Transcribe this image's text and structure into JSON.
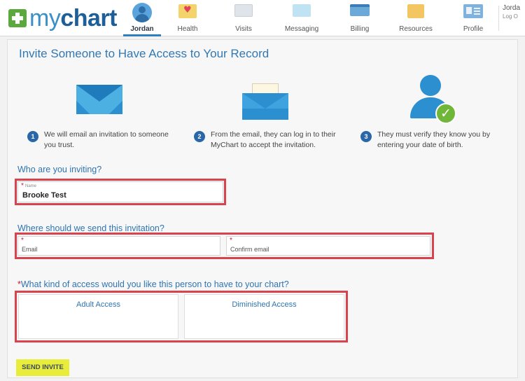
{
  "brand": {
    "my": "my",
    "chart": "chart"
  },
  "nav": {
    "user": "Jordan",
    "items": [
      "Health",
      "Visits",
      "Messaging",
      "Billing",
      "Resources",
      "Profile"
    ],
    "corner_user": "Jorda",
    "corner_logout": "Log O"
  },
  "page": {
    "title": "Invite Someone to Have Access to Your Record"
  },
  "steps": [
    {
      "num": "1",
      "line1": "We will email an invitation to someone",
      "line2": "you trust."
    },
    {
      "num": "2",
      "line1": "From the email, they can log in to their",
      "line2": "MyChart to accept the invitation."
    },
    {
      "num": "3",
      "line1": "They must verify they know you by",
      "line2": "entering your date of birth."
    }
  ],
  "form": {
    "who_label": "Who are you inviting?",
    "name_label": "Name",
    "name_value": "Brooke Test",
    "where_label": "Where should we send this invitation?",
    "email_placeholder": "Email",
    "confirm_placeholder": "Confirm email",
    "access_question": "What kind of access would you like this person to have to your chart?",
    "access_options": [
      "Adult Access",
      "Diminished Access"
    ],
    "required_mark": "*",
    "send_label": "SEND INVITE"
  },
  "colors": {
    "accent_blue": "#2f74b0",
    "highlight_red": "#d9434d",
    "send_button": "#e8ec3a",
    "check_green": "#6fb639"
  }
}
